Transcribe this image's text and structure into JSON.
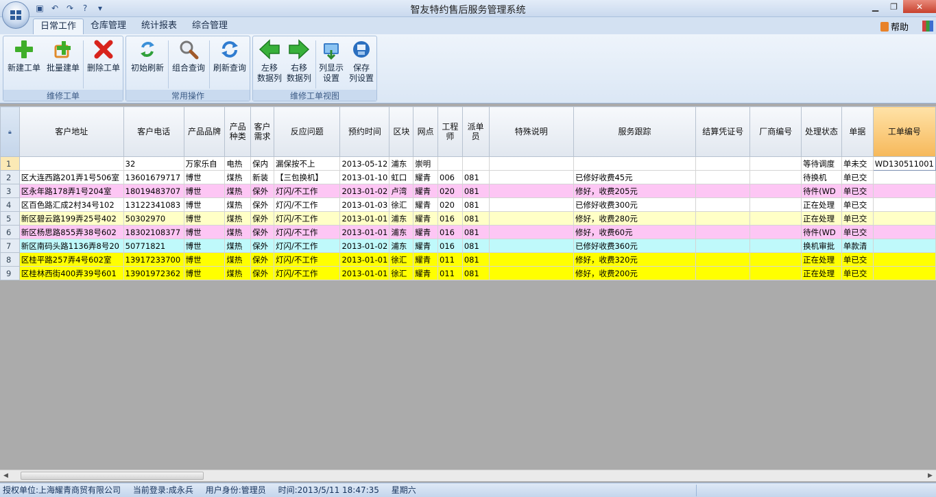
{
  "window": {
    "title": "智友特约售后服务管理系统",
    "quick_access_icons": [
      "save-icon",
      "undo-icon",
      "redo-icon",
      "help-circle-icon",
      "customize-dropdown-icon"
    ],
    "buttons": {
      "minimize": "▁",
      "maximize": "❐",
      "close": "✕"
    }
  },
  "tabs": [
    {
      "label": "日常工作",
      "active": true
    },
    {
      "label": "仓库管理"
    },
    {
      "label": "统计报表"
    },
    {
      "label": "综合管理"
    }
  ],
  "help_label": "帮助",
  "ribbon": {
    "groups": [
      {
        "label": "维修工单",
        "buttons": [
          {
            "label": "新建工单",
            "icon": "plus-icon"
          },
          {
            "label": "批量建单",
            "icon": "batch-add-icon"
          },
          {
            "label": "删除工单",
            "icon": "delete-x-icon"
          }
        ]
      },
      {
        "label": "常用操作",
        "buttons": [
          {
            "label": "初始刷新",
            "icon": "refresh-init-icon"
          },
          {
            "label": "组合查询",
            "icon": "magnifier-icon"
          },
          {
            "label": "刷新查询",
            "icon": "refresh-icon"
          }
        ]
      },
      {
        "label": "维修工单视图",
        "buttons": [
          {
            "label1": "左移",
            "label2": "数据列",
            "icon": "arrow-left-icon"
          },
          {
            "label1": "右移",
            "label2": "数据列",
            "icon": "arrow-right-icon"
          },
          {
            "label1": "列显示",
            "label2": "设置",
            "icon": "column-display-icon"
          },
          {
            "label1": "保存",
            "label2": "列设置",
            "icon": "save-disk-icon"
          }
        ]
      }
    ]
  },
  "grid": {
    "columns": [
      {
        "label": "客户地址"
      },
      {
        "label": "客户电话"
      },
      {
        "label": "产品品牌"
      },
      {
        "label": "产品种类"
      },
      {
        "label": "客户需求"
      },
      {
        "label": "反应问题"
      },
      {
        "label": "预约时间"
      },
      {
        "label": "区块"
      },
      {
        "label": "网点"
      },
      {
        "label": "工程师"
      },
      {
        "label": "派单员"
      },
      {
        "label": "特殊说明"
      },
      {
        "label": "服务跟踪"
      },
      {
        "label": "结算凭证号"
      },
      {
        "label": "厂商编号"
      },
      {
        "label": "处理状态"
      },
      {
        "label": "单据"
      },
      {
        "label": "工单编号",
        "selected": true
      }
    ],
    "row_colors": {
      "white": "#ffffff",
      "pink": "#fdc6f4",
      "light_yellow": "#ffffc6",
      "cyan": "#bff9fb",
      "yellow": "#ffff00"
    },
    "rows": [
      {
        "num": "1",
        "color": "white",
        "current": true,
        "cells": [
          "",
          "32",
          "万家乐自",
          "电热",
          "保内",
          "漏保按不上",
          "2013-05-12",
          "浦东",
          "崇明",
          "",
          "",
          "",
          "",
          "",
          "",
          "等待调度",
          "单未交",
          "WD130511001"
        ]
      },
      {
        "num": "2",
        "color": "white",
        "cells": [
          "区大连西路201弄1号506室",
          "13601679717",
          "博世",
          "煤热",
          "新装",
          "【三包换机】",
          "2013-01-10",
          "虹口",
          "耀青",
          "006",
          "081",
          "",
          "已修好收费45元",
          "",
          "",
          "待换机",
          "单已交",
          ""
        ]
      },
      {
        "num": "3",
        "color": "pink",
        "cells": [
          "区永年路178弄1号204室",
          "18019483707",
          "博世",
          "煤热",
          "保外",
          "灯闪/不工作",
          "2013-01-02",
          "卢湾",
          "耀青",
          "020",
          "081",
          "",
          "修好，收费205元",
          "",
          "",
          "待件(WD",
          "单已交",
          ""
        ]
      },
      {
        "num": "4",
        "color": "white",
        "cells": [
          "区百色路汇成2村34号102",
          "13122341083",
          "博世",
          "煤热",
          "保外",
          "灯闪/不工作",
          "2013-01-03",
          "徐汇",
          "耀青",
          "020",
          "081",
          "",
          "已修好收费300元",
          "",
          "",
          "正在处理",
          "单已交",
          ""
        ]
      },
      {
        "num": "5",
        "color": "light_yellow",
        "cells": [
          "新区碧云路199弄25号402",
          "50302970",
          "博世",
          "煤热",
          "保外",
          "灯闪/不工作",
          "2013-01-01",
          "浦东",
          "耀青",
          "016",
          "081",
          "",
          "修好，收费280元",
          "",
          "",
          "正在处理",
          "单已交",
          ""
        ]
      },
      {
        "num": "6",
        "color": "pink",
        "cells": [
          "新区杨思路855弄38号602",
          "18302108377",
          "博世",
          "煤热",
          "保外",
          "灯闪/不工作",
          "2013-01-01",
          "浦东",
          "耀青",
          "016",
          "081",
          "",
          "修好，收费60元",
          "",
          "",
          "待件(WD",
          "单已交",
          ""
        ]
      },
      {
        "num": "7",
        "color": "cyan",
        "cells": [
          "新区南码头路1136弄8号20",
          "50771821",
          "博世",
          "煤热",
          "保外",
          "灯闪/不工作",
          "2013-01-02",
          "浦东",
          "耀青",
          "016",
          "081",
          "",
          "已修好收费360元",
          "",
          "",
          "换机审批",
          "单款清",
          ""
        ]
      },
      {
        "num": "8",
        "color": "yellow",
        "cells": [
          "区桂平路257弄4号602室",
          "13917233700",
          "博世",
          "煤热",
          "保外",
          "灯闪/不工作",
          "2013-01-01",
          "徐汇",
          "耀青",
          "011",
          "081",
          "",
          "修好，收费320元",
          "",
          "",
          "正在处理",
          "单已交",
          ""
        ]
      },
      {
        "num": "9",
        "color": "yellow",
        "cells": [
          "区桂林西街400弄39号601",
          "13901972362",
          "博世",
          "煤热",
          "保外",
          "灯闪/不工作",
          "2013-01-01",
          "徐汇",
          "耀青",
          "011",
          "081",
          "",
          "修好，收费200元",
          "",
          "",
          "正在处理",
          "单已交",
          ""
        ]
      }
    ]
  },
  "status_bar": {
    "company": "授权单位:上海耀青商贸有限公司",
    "login": "当前登录:成永兵",
    "role": "用户身份:管理员",
    "time": "时间:2013/5/11 18:47:35",
    "weekday": "星期六"
  }
}
